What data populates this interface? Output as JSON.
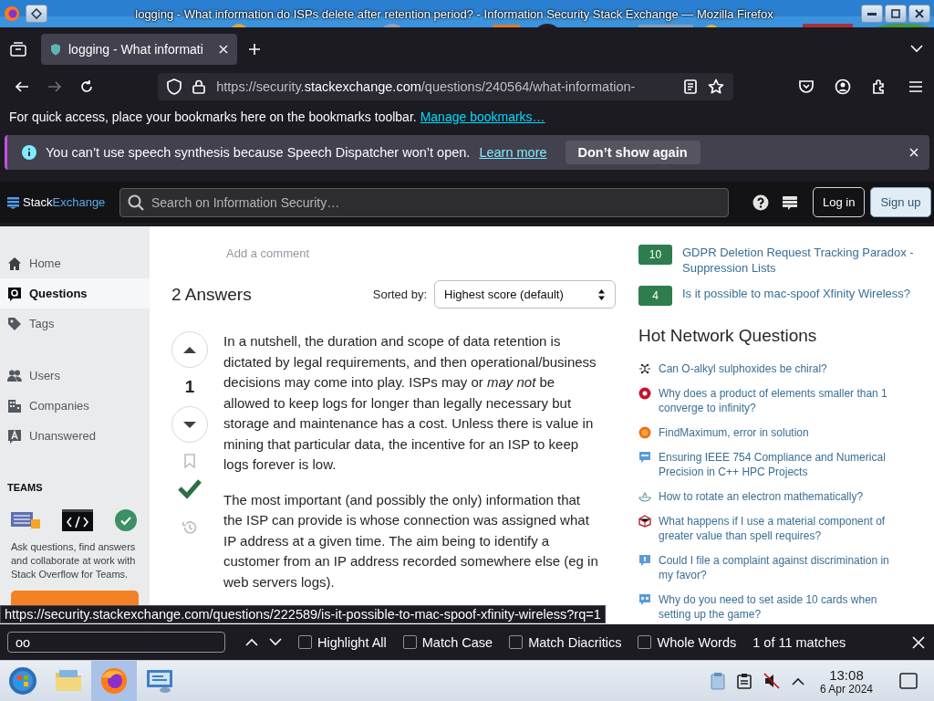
{
  "window": {
    "title": "logging - What information do ISPs delete after retention period? - Information Security Stack Exchange — Mozilla Firefox"
  },
  "tabs": [
    {
      "label": "logging - What informati",
      "selected": true
    }
  ],
  "address_bar": {
    "url_start": "https://security.",
    "url_domain": "stackexchange.com",
    "url_path": "/questions/240564/what-information-"
  },
  "bookmarks_bar": {
    "text": "For quick access, place your bookmarks here on the bookmarks toolbar.",
    "link": "Manage bookmarks…"
  },
  "notification": {
    "message": "You can’t use speech synthesis because Speech Dispatcher won’t open.",
    "link": "Learn more",
    "button": "Don’t show again"
  },
  "site_header": {
    "logo_first": "Stack",
    "logo_second": "Exchange",
    "search_placeholder": "Search on Information Security…",
    "login": "Log in",
    "signup": "Sign up"
  },
  "sidebar": {
    "groups": [
      [
        {
          "label": "Home",
          "selected": false
        },
        {
          "label": "Questions",
          "selected": true
        },
        {
          "label": "Tags",
          "selected": false
        }
      ],
      [
        {
          "label": "Users",
          "selected": false
        },
        {
          "label": "Companies",
          "selected": false
        },
        {
          "label": "Unanswered",
          "selected": false
        }
      ]
    ],
    "teams_heading": "TEAMS",
    "teams_text": "Ask questions, find answers and collaborate at work with Stack Overflow for Teams."
  },
  "comment_link": "Add a comment",
  "answers_header": {
    "count": "2 Answers",
    "sort_label": "Sorted by:",
    "sort_value": "Highest score (default)"
  },
  "answer": {
    "score": "1",
    "accepted": true,
    "paragraphs": [
      "In a nutshell, the duration and scope of data retention is dictated by legal requirements, and then operational/business decisions may come into play. ISPs may or *may not* be allowed to keep logs for longer than legally necessary but storage and maintenance has a cost. Unless there is value in mining that particular data, the incentive for an ISP to keep logs forever is low.",
      "The most important (and possibly the only) information that the ISP can provide is whose connection was assigned what IP address at a given time. The aim being to identify a customer from an IP address recorded somewhere else (eg in web servers logs)."
    ]
  },
  "related": [
    {
      "score": "10",
      "title": "GDPR Deletion Request Tracking Paradox - Suppression Lists"
    },
    {
      "score": "4",
      "title": "Is it possible to mac-spoof Xfinity Wireless?"
    }
  ],
  "hot_network": {
    "heading": "Hot Network Questions",
    "items": [
      {
        "title": "Can O-alkyl sulphoxides be chiral?"
      },
      {
        "title": "Why does a product of elements smaller than 1 converge to infinity?"
      },
      {
        "title": "FindMaximum, error in solution"
      },
      {
        "title": "Ensuring IEEE 754 Compliance and Numerical Precision in C++ HPC Projects"
      },
      {
        "title": "How to rotate an electron mathematically?"
      },
      {
        "title": "What happens if I use a material component of greater value than spell requires?"
      },
      {
        "title": "Could I file a complaint against discrimination in my favor?"
      },
      {
        "title": "Why do you need to set aside 10 cards when setting up the game?"
      }
    ]
  },
  "status_url": "https://security.stackexchange.com/questions/222589/is-it-possible-to-mac-spoof-xfinity-wireless?rq=1",
  "find_bar": {
    "value": "oo",
    "options": [
      {
        "label": "Highlight All",
        "checked": false
      },
      {
        "label": "Match Case",
        "checked": false
      },
      {
        "label": "Match Diacritics",
        "checked": false
      },
      {
        "label": "Whole Words",
        "checked": false
      }
    ],
    "result": "1 of 11 matches"
  },
  "taskbar": {
    "apps": [
      {
        "selected": false
      },
      {
        "selected": false
      },
      {
        "selected": true
      },
      {
        "selected": false
      }
    ],
    "time": "13:08",
    "date": "6 Apr 2024"
  }
}
